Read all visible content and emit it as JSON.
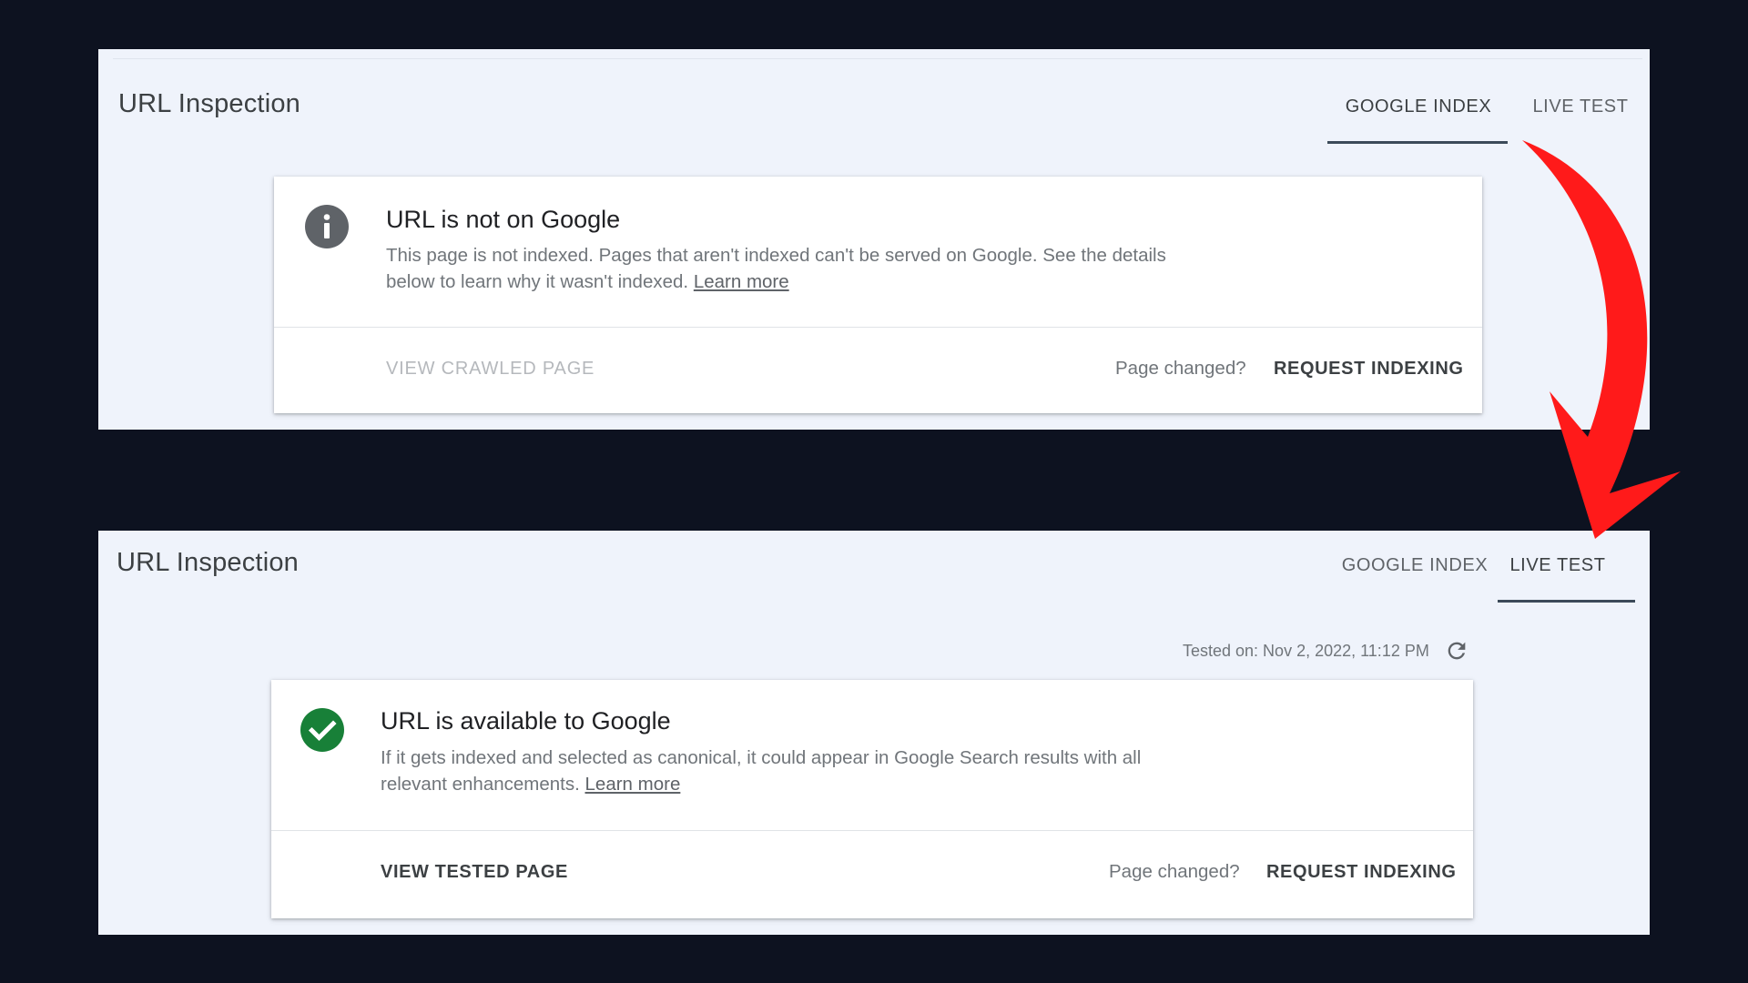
{
  "colors": {
    "background": "#0d1220",
    "panel": "#eff3fb",
    "success_green": "#188038",
    "info_gray": "#5f6368",
    "arrow_red": "#ff1a1a"
  },
  "top_panel": {
    "title": "URL Inspection",
    "tabs": [
      {
        "label": "GOOGLE INDEX",
        "active": true
      },
      {
        "label": "LIVE TEST",
        "active": false
      }
    ],
    "card": {
      "icon": "info-icon",
      "title": "URL is not on Google",
      "description": "This page is not indexed. Pages that aren't indexed can't be served on Google. See the details below to learn why it wasn't indexed.",
      "learn_more": "Learn more",
      "view_button": "VIEW CRAWLED PAGE",
      "view_button_enabled": false,
      "page_changed": "Page changed?",
      "request_button": "REQUEST INDEXING"
    }
  },
  "bottom_panel": {
    "title": "URL Inspection",
    "tabs": [
      {
        "label": "GOOGLE INDEX",
        "active": false
      },
      {
        "label": "LIVE TEST",
        "active": true
      }
    ],
    "tested_on": "Tested on: Nov 2, 2022, 11:12 PM",
    "refresh_icon": "refresh-icon",
    "card": {
      "icon": "check-circle-icon",
      "title": "URL is available to Google",
      "description": "If it gets indexed and selected as canonical, it could appear in Google Search results with all relevant enhancements.",
      "learn_more": "Learn more",
      "view_button": "VIEW TESTED PAGE",
      "view_button_enabled": true,
      "page_changed": "Page changed?",
      "request_button": "REQUEST INDEXING"
    }
  },
  "overlay": {
    "icon": "curved-arrow-icon"
  }
}
